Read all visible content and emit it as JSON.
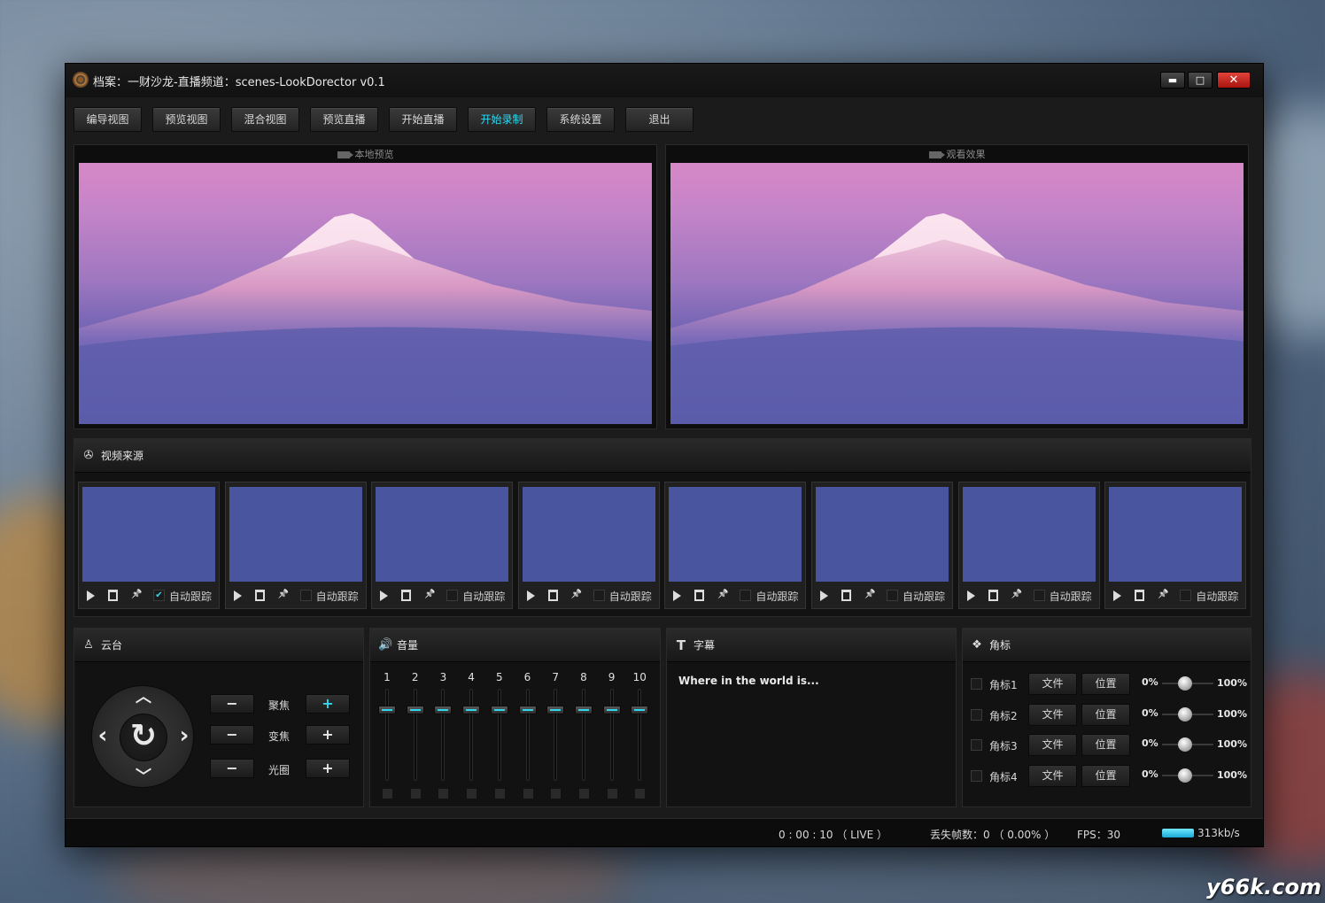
{
  "titlebar": {
    "title": "档案：一财沙龙-直播频道：scenes-LookDorector v0.1",
    "minimize": "▬",
    "maximize": "□",
    "close": "✕"
  },
  "toolbar": {
    "buttons": [
      "编导视图",
      "预览视图",
      "混合视图",
      "预览直播",
      "开始直播",
      "开始录制",
      "系统设置",
      "退出"
    ],
    "active_index": 5
  },
  "previews": {
    "local_label": "本地预览",
    "watch_label": "观看效果"
  },
  "sources": {
    "title": "视频来源",
    "auto_track_label": "自动跟踪",
    "cards": [
      {
        "auto_track": true
      },
      {
        "auto_track": false
      },
      {
        "auto_track": false
      },
      {
        "auto_track": false
      },
      {
        "auto_track": false
      },
      {
        "auto_track": false
      },
      {
        "auto_track": false
      },
      {
        "auto_track": false
      }
    ]
  },
  "ptz": {
    "title": "云台",
    "minus": "−",
    "plus": "+",
    "rows": [
      {
        "label": "聚焦",
        "plus_active": true
      },
      {
        "label": "变焦",
        "plus_active": false
      },
      {
        "label": "光圈",
        "plus_active": false
      }
    ],
    "arrows": {
      "up": "︿",
      "down": "﹀",
      "left": "‹",
      "right": "›",
      "center": "↻"
    }
  },
  "volume": {
    "title": "音量",
    "channels": [
      "1",
      "2",
      "3",
      "4",
      "5",
      "6",
      "7",
      "8",
      "9",
      "10"
    ]
  },
  "caption": {
    "title": "字幕",
    "text": "Where in the world is..."
  },
  "logos": {
    "title": "角标",
    "file_label": "文件",
    "position_label": "位置",
    "min_label": "0%",
    "max_label": "100%",
    "items": [
      {
        "label": "角标1"
      },
      {
        "label": "角标2"
      },
      {
        "label": "角标3"
      },
      {
        "label": "角标4"
      }
    ]
  },
  "status": {
    "time": "0 : 00 : 10 （ LIVE ）",
    "dropped": "丢失帧数：0 （ 0.00% ）",
    "fps": "FPS：30",
    "bitrate": "313kb/s"
  },
  "watermark": "y66k.com",
  "colors": {
    "accent": "#2fd8f0",
    "close": "#c8261c",
    "thumb": "#4a55a0"
  }
}
